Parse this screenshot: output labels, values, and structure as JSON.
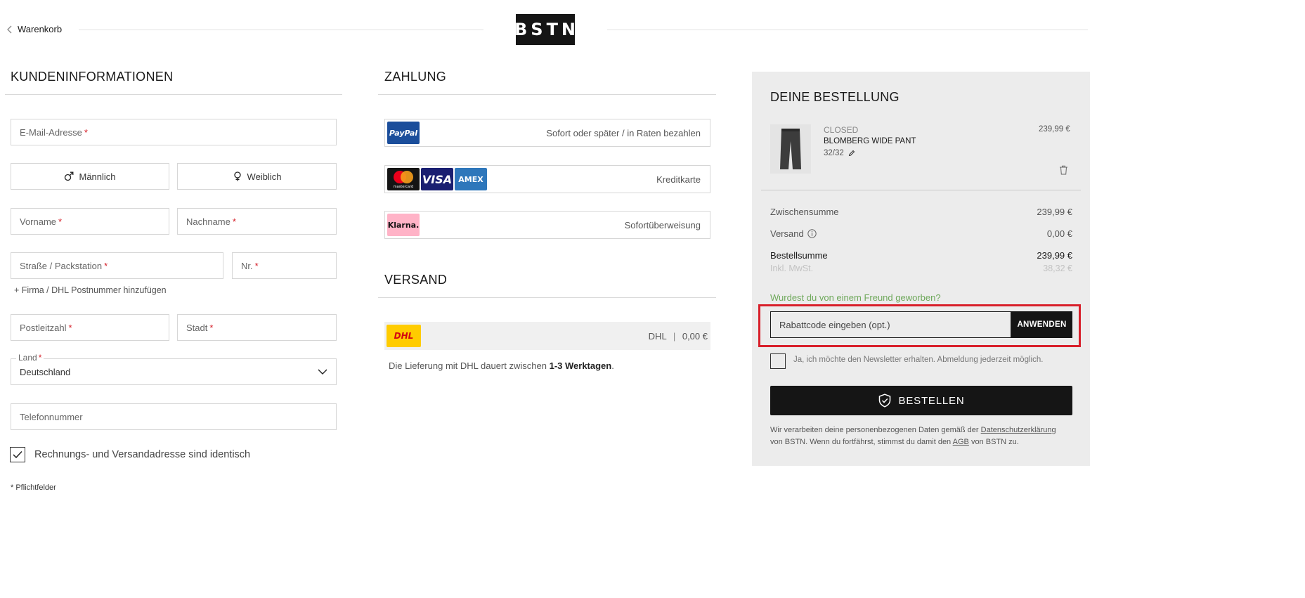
{
  "header": {
    "back_label": "Warenkorb",
    "logo_text": "BSTN"
  },
  "customer": {
    "title": "KUNDENINFORMATIONEN",
    "email_placeholder": "E-Mail-Adresse",
    "gender_male": "Männlich",
    "gender_female": "Weiblich",
    "firstname_placeholder": "Vorname",
    "lastname_placeholder": "Nachname",
    "street_placeholder": "Straße / Packstation",
    "number_placeholder": "Nr.",
    "company_link": "+ Firma / DHL Postnummer hinzufügen",
    "zip_placeholder": "Postleitzahl",
    "city_placeholder": "Stadt",
    "country_label": "Land",
    "country_value": "Deutschland",
    "phone_placeholder": "Telefonnummer",
    "same_address_label": "Rechnungs- und Versandadresse sind identisch",
    "same_address_checked": true,
    "required_star": "*",
    "required_note": "* Pflichtfelder"
  },
  "payment": {
    "title": "ZAHLUNG",
    "options": [
      {
        "logos": [
          "PayPal"
        ],
        "label": "Sofort oder später / in Raten bezahlen"
      },
      {
        "logos": [
          "mastercard",
          "VISA",
          "AMEX"
        ],
        "label": "Kreditkarte"
      },
      {
        "logos": [
          "Klarna."
        ],
        "label": "Sofortüberweisung"
      }
    ]
  },
  "shipping": {
    "title": "VERSAND",
    "carrier_logo": "DHL",
    "carrier": "DHL",
    "separator": "|",
    "price": "0,00 €",
    "note_prefix": "Die Lieferung mit DHL dauert zwischen",
    "note_bold": "1-3 Werktagen",
    "note_suffix": "."
  },
  "order": {
    "title": "DEINE BESTELLUNG",
    "item": {
      "brand": "CLOSED",
      "name": "BLOMBERG WIDE PANT",
      "size": "32/32",
      "price": "239,99 €"
    },
    "subtotal_label": "Zwischensumme",
    "subtotal_value": "239,99 €",
    "shipping_label": "Versand",
    "shipping_value": "0,00 €",
    "total_label": "Bestellsumme",
    "total_value": "239,99 €",
    "vat_label": "Inkl. MwSt.",
    "vat_value": "38,32 €",
    "referral_link": "Wurdest du von einem Freund geworben?",
    "coupon_placeholder": "Rabattcode eingeben (opt.)",
    "coupon_button": "ANWENDEN",
    "newsletter_label": "Ja, ich möchte den Newsletter erhalten. Abmeldung jederzeit möglich.",
    "newsletter_checked": false,
    "order_button": "BESTELLEN",
    "legal_1": "Wir verarbeiten deine personenbezogenen Daten gemäß der",
    "legal_privacy_link": "Datenschutzerklärung",
    "legal_2": "von BSTN. Wenn du fortfährst, stimmst du damit den",
    "legal_agb_link": "AGB",
    "legal_3": "von BSTN zu."
  },
  "colors": {
    "accent_dark": "#151515",
    "highlight_red": "#d81f2a",
    "referral_green": "#6ea85a",
    "panel_bg": "#ececec",
    "paypal_blue": "#1b4e9b",
    "klarna_pink": "#ffb3c7",
    "dhl_yellow": "#ffcc00",
    "dhl_red": "#d40511"
  }
}
